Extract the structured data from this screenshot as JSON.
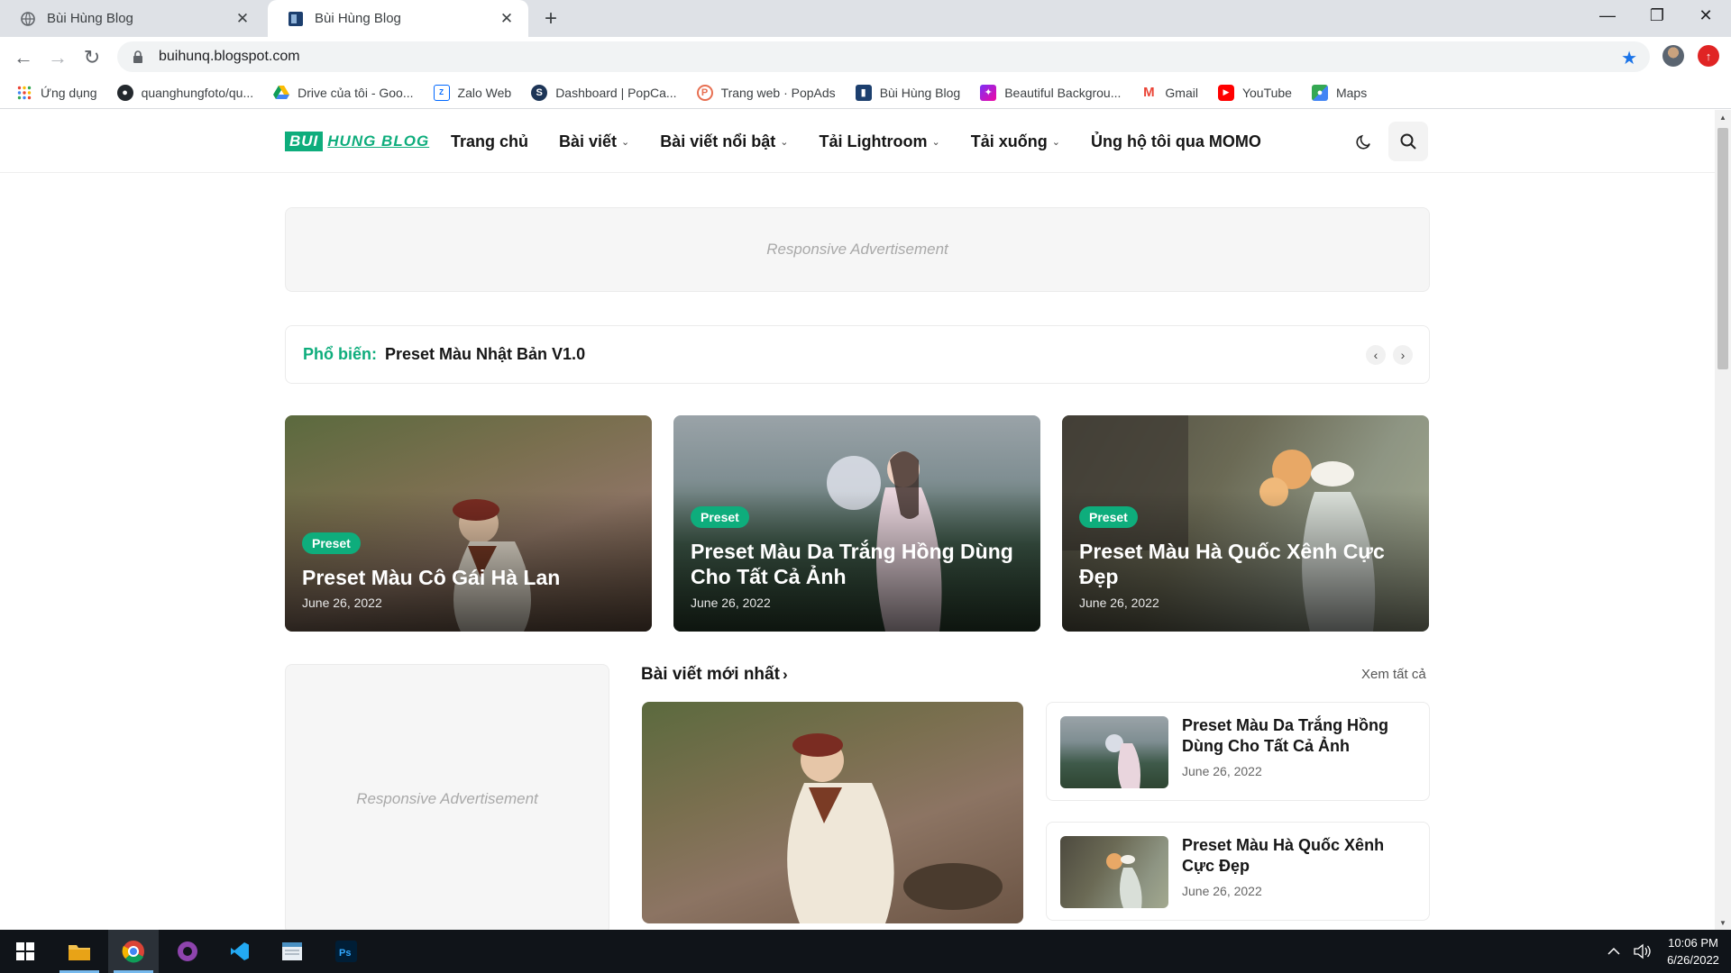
{
  "browser": {
    "tabs": [
      {
        "title": "Bùi Hùng Blog",
        "active": false
      },
      {
        "title": "Bùi Hùng Blog",
        "active": true
      }
    ],
    "url": "buihunq.blogspot.com",
    "bookmarks": [
      {
        "label": "Ứng dụng",
        "icon": "apps-grid-icon"
      },
      {
        "label": "quanghungfoto/qu...",
        "icon": "github-icon"
      },
      {
        "label": "Drive của tôi - Goo...",
        "icon": "google-drive-icon"
      },
      {
        "label": "Zalo Web",
        "icon": "zalo-icon"
      },
      {
        "label": "Dashboard | PopCa...",
        "icon": "popcash-icon"
      },
      {
        "label": "Trang web · PopAds",
        "icon": "popads-icon"
      },
      {
        "label": "Bùi Hùng Blog",
        "icon": "blog-favicon-icon"
      },
      {
        "label": "Beautiful Backgrou...",
        "icon": "backgrounds-icon"
      },
      {
        "label": "Gmail",
        "icon": "gmail-icon"
      },
      {
        "label": "YouTube",
        "icon": "youtube-icon"
      },
      {
        "label": "Maps",
        "icon": "maps-icon"
      }
    ]
  },
  "site": {
    "logo": {
      "part1": "BUI",
      "part2": "HUNG BLOG"
    },
    "nav": [
      {
        "label": "Trang chủ",
        "dropdown": false
      },
      {
        "label": "Bài viết",
        "dropdown": true
      },
      {
        "label": "Bài viết nổi bật",
        "dropdown": true
      },
      {
        "label": "Tải Lightroom",
        "dropdown": true
      },
      {
        "label": "Tải xuống",
        "dropdown": true
      },
      {
        "label": "Ủng hộ tôi qua MOMO",
        "dropdown": false
      }
    ],
    "ad_text": "Responsive Advertisement",
    "popular": {
      "label": "Phổ biến:",
      "title": "Preset Màu Nhật Bản V1.0"
    },
    "featured": [
      {
        "tag": "Preset",
        "title": "Preset Màu Cô Gái Hà Lan",
        "date": "June 26, 2022"
      },
      {
        "tag": "Preset",
        "title": "Preset Màu Da Trắng Hồng Dùng Cho Tất Cả Ảnh",
        "date": "June 26, 2022"
      },
      {
        "tag": "Preset",
        "title": "Preset Màu Hà Quốc Xênh Cực Đẹp",
        "date": "June 26, 2022"
      }
    ],
    "latest": {
      "heading": "Bài viết mới nhất",
      "see_all": "Xem tất cả",
      "items": [
        {
          "title": "Preset Màu Da Trắng Hồng Dùng Cho Tất Cả Ảnh",
          "date": "June 26, 2022"
        },
        {
          "title": "Preset Màu Hà Quốc Xênh Cực Đẹp",
          "date": "June 26, 2022"
        }
      ]
    },
    "accent_color": "#0ead7c"
  },
  "taskbar": {
    "apps": [
      "windows-start-icon",
      "file-explorer-icon",
      "chrome-icon",
      "github-desktop-icon",
      "vscode-icon",
      "notepad-icon",
      "photoshop-icon"
    ],
    "time": "10:06 PM",
    "date": "6/26/2022"
  }
}
